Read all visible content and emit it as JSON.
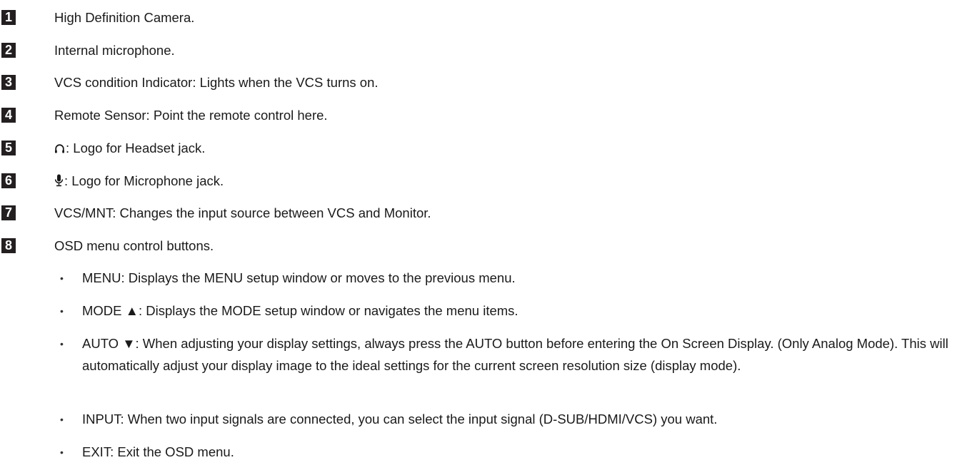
{
  "items": [
    {
      "number": "1",
      "text": "High Definition Camera."
    },
    {
      "number": "2",
      "text": "Internal microphone."
    },
    {
      "number": "3",
      "text": "VCS condition Indicator: Lights when the VCS turns on."
    },
    {
      "number": "4",
      "text": "Remote Sensor: Point the remote control here."
    },
    {
      "number": "5",
      "text": ": Logo for Headset jack.",
      "icon": "headset-icon"
    },
    {
      "number": "6",
      "text": ": Logo for Microphone jack.",
      "icon": "microphone-icon"
    },
    {
      "number": "7",
      "text": "VCS/MNT: Changes the input source between VCS and Monitor."
    },
    {
      "number": "8",
      "text": "OSD menu control buttons."
    }
  ],
  "bullets": [
    {
      "marker": "•",
      "text": "MENU: Displays the MENU setup window or moves to the previous menu."
    },
    {
      "marker": "•",
      "text": "MODE ▲: Displays the MODE setup window or navigates the menu items."
    },
    {
      "marker": "•",
      "text": "AUTO ▼: When adjusting your display settings, always press the AUTO button before entering the On Screen Display. (Only Analog Mode). This will automatically adjust your display image to the ideal settings for the current screen resolution size (display mode)."
    },
    {
      "marker": "•",
      "text": "INPUT: When two input signals are connected, you can select the input signal (D-SUB/HDMI/VCS) you want."
    },
    {
      "marker": "•",
      "text": "EXIT: Exit the OSD menu."
    }
  ]
}
